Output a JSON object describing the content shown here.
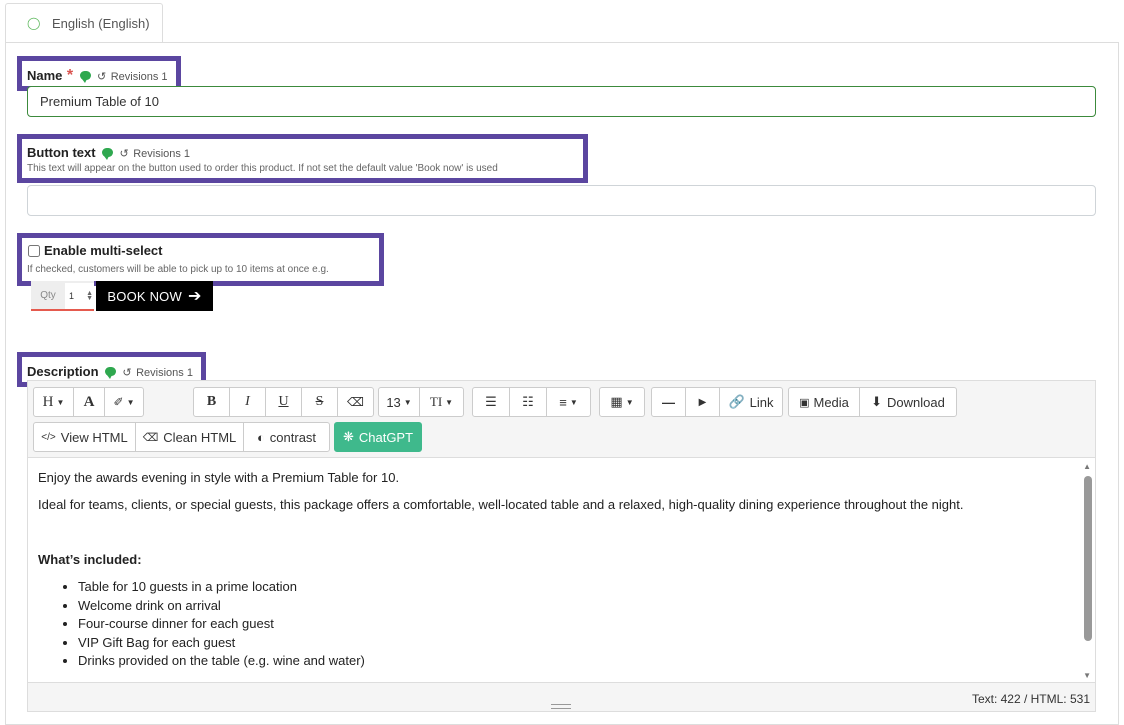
{
  "tab": {
    "icon": "speech-bubble-icon",
    "label": "English (English)"
  },
  "name_field": {
    "label": "Name",
    "required_mark": "*",
    "revisions": "Revisions 1",
    "value": "Premium Table of 10"
  },
  "button_text_field": {
    "label": "Button text",
    "revisions": "Revisions 1",
    "help": "This text will appear on the button used to order this product. If not set the default value 'Book now' is used",
    "value": ""
  },
  "multi_select": {
    "label": "Enable multi-select",
    "checked": false,
    "help": "If checked, customers will be able to pick up to 10 items at once e.g."
  },
  "preview": {
    "qty_label": "Qty",
    "qty_value": "1",
    "book_label": "BOOK NOW",
    "book_arrow": "➔"
  },
  "description": {
    "label": "Description",
    "revisions": "Revisions 1"
  },
  "toolbar": {
    "heading": "H",
    "font_color": "A",
    "brush": "🖌",
    "bold": "B",
    "italic": "I",
    "underline": "U",
    "strike": "S",
    "eraser": "⌫",
    "font_size": "13",
    "line_height": "TI",
    "bullet_list": "☰",
    "ordered_list": "☷",
    "align": "≡",
    "table": "▦",
    "hr": "—",
    "video": "▶",
    "link_label": "Link",
    "media_label": "Media",
    "download_label": "Download",
    "view_html_label": "View HTML",
    "clean_html_label": "Clean HTML",
    "contrast_label": "contrast",
    "chatgpt_label": "ChatGPT"
  },
  "content": {
    "p1": "Enjoy the awards evening in style with a Premium Table for 10.",
    "p2": "Ideal for teams, clients, or special guests, this package offers a comfortable, well-located table and a relaxed, high-quality dining experience throughout the night.",
    "heading": "What’s included:",
    "items": [
      "Table for 10 guests in a prime location",
      "Welcome drink on arrival",
      "Four-course dinner for each guest",
      "VIP Gift Bag for each guest",
      "Drinks provided on the table (e.g. wine and water)"
    ]
  },
  "status": {
    "counts": "Text: 422 / HTML: 531"
  },
  "colors": {
    "highlight": "#5b46a0",
    "accent_green": "#2fa84f",
    "chatgpt": "#3fb98c",
    "required": "#d9534f"
  }
}
